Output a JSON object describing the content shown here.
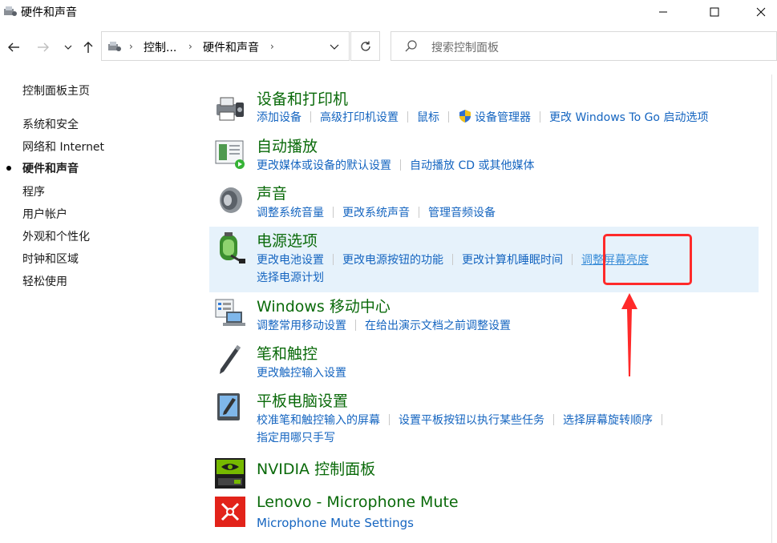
{
  "window": {
    "title": "硬件和声音"
  },
  "colors": {
    "link": "#1565c0",
    "heading": "#0a6a0a",
    "highlight": "#e6f2fb",
    "annotation": "#ff2a2a"
  },
  "address_bar": {
    "crumbs": [
      "控制...",
      "硬件和声音"
    ]
  },
  "search": {
    "placeholder": "搜索控制面板"
  },
  "left_nav": {
    "home": "控制面板主页",
    "items": [
      "系统和安全",
      "网络和 Internet",
      "硬件和声音",
      "程序",
      "用户帐户",
      "外观和个性化",
      "时钟和区域",
      "轻松使用"
    ],
    "active_index": 2
  },
  "categories": [
    {
      "title": "设备和打印机",
      "icon": "printer-icon",
      "links": [
        "添加设备",
        "高级打印机设置",
        "鼠标",
        "设备管理器",
        "更改 Windows To Go 启动选项"
      ]
    },
    {
      "title": "自动播放",
      "icon": "autoplay-icon",
      "links": [
        "更改媒体或设备的默认设置",
        "自动播放 CD 或其他媒体"
      ]
    },
    {
      "title": "声音",
      "icon": "speaker-icon",
      "links": [
        "调整系统音量",
        "更改系统声音",
        "管理音频设备"
      ]
    },
    {
      "title": "电源选项",
      "icon": "battery-icon",
      "links": [
        "更改电池设置",
        "更改电源按钮的功能",
        "更改计算机睡眠时间",
        "调整屏幕亮度",
        "选择电源计划"
      ]
    },
    {
      "title": "Windows 移动中心",
      "icon": "mobility-center-icon",
      "links": [
        "调整常用移动设置",
        "在给出演示文档之前调整设置"
      ]
    },
    {
      "title": "笔和触控",
      "icon": "pen-icon",
      "links": [
        "更改触控输入设置"
      ]
    },
    {
      "title": "平板电脑设置",
      "icon": "tablet-icon",
      "links": [
        "校准笔和触控输入的屏幕",
        "设置平板按钮以执行某些任务",
        "选择屏幕旋转顺序",
        "指定用哪只手写"
      ]
    },
    {
      "title": "NVIDIA 控制面板",
      "icon": "nvidia-icon",
      "links": []
    },
    {
      "title": "Lenovo - Microphone Mute",
      "icon": "microphone-mute-icon",
      "links": [
        "Microphone Mute Settings"
      ]
    }
  ]
}
